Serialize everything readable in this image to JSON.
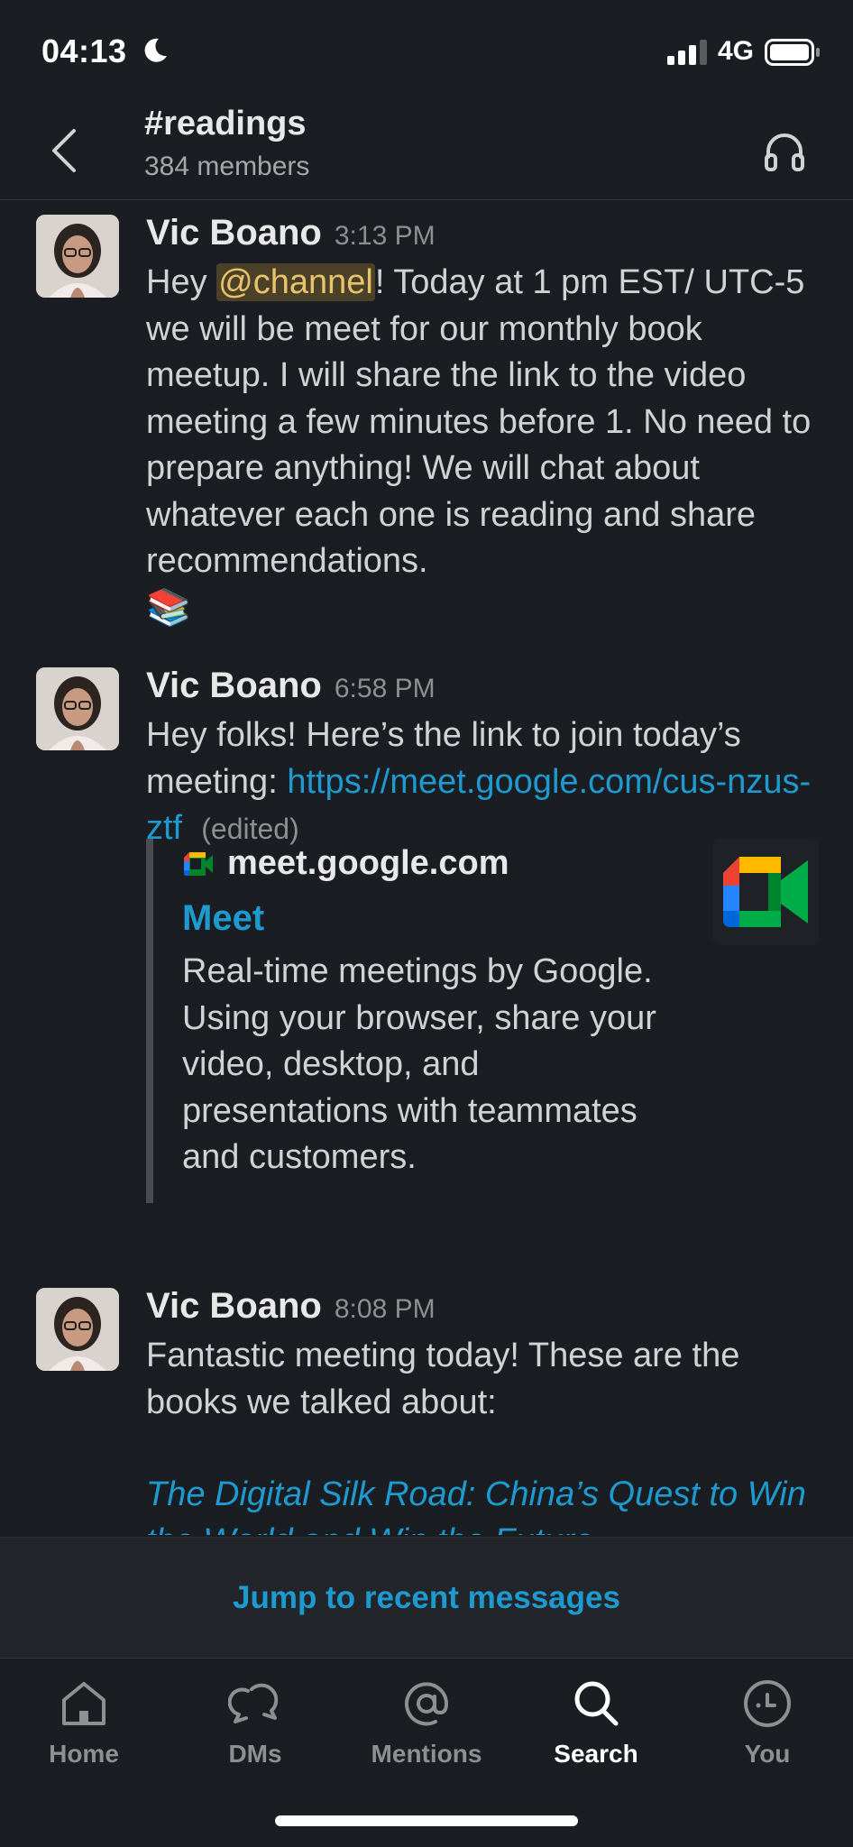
{
  "status_bar": {
    "time": "04:13",
    "network": "4G"
  },
  "header": {
    "channel": "#readings",
    "members": "384 members"
  },
  "messages": [
    {
      "author": "Vic Boano",
      "time": "3:13 PM",
      "text_before": "Hey ",
      "mention": "@channel",
      "text_after": "! Today at 1 pm EST/ UTC-5 we will be meet for our monthly book meetup. I will share the link to the video meeting a few minutes before 1. No need to prepare anything! We will chat about whatever each one is reading and share recommendations.",
      "emoji": "📚"
    },
    {
      "author": "Vic Boano",
      "time": "6:58 PM",
      "text_before": "Hey folks! Here’s the link to join today’s meeting: ",
      "link": "https://meet.google.com/cus-nzus-ztf",
      "edited": "(edited)",
      "unfurl": {
        "site": "meet.google.com",
        "title": "Meet",
        "description": "Real-time meetings by Google. Using your browser, share your video, desktop, and presentations with teammates and customers."
      }
    },
    {
      "author": "Vic Boano",
      "time": "8:08 PM",
      "text": "Fantastic meeting today! These are the books we talked about:",
      "book_link": "The Digital Silk Road: China’s Quest to Win the World and Win the Future"
    }
  ],
  "jump_bar": {
    "label": "Jump to recent messages"
  },
  "tabs": [
    {
      "label": "Home",
      "icon": "home-icon"
    },
    {
      "label": "DMs",
      "icon": "dms-icon"
    },
    {
      "label": "Mentions",
      "icon": "mentions-icon"
    },
    {
      "label": "Search",
      "icon": "search-icon",
      "active": true
    },
    {
      "label": "You",
      "icon": "you-icon"
    }
  ],
  "colors": {
    "background": "#1a1d21",
    "link": "#1d9bd1",
    "mention_bg": "#4a4128",
    "mention_fg": "#e7c46a"
  }
}
